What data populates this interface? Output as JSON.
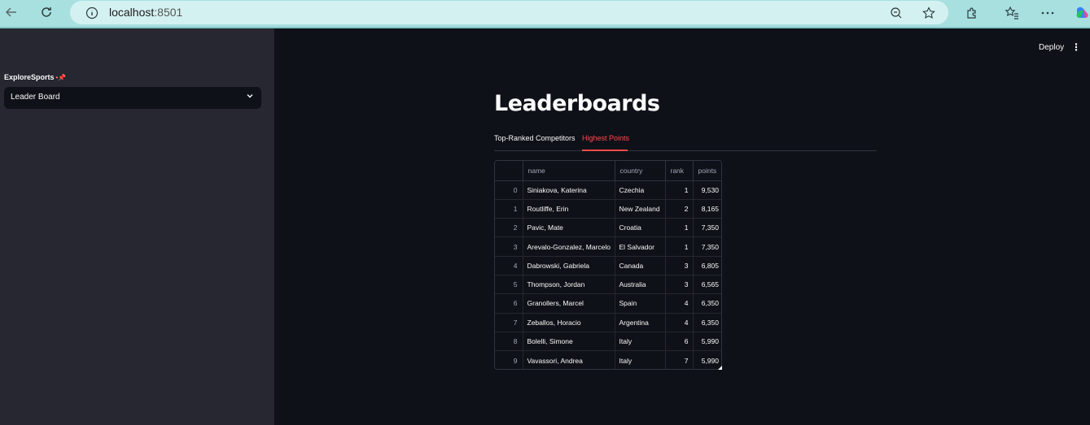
{
  "browser": {
    "url_host": "localhost",
    "url_port": ":8501"
  },
  "sidebar": {
    "label": "ExploreSports",
    "select_value": "Leader Board"
  },
  "header": {
    "deploy_label": "Deploy"
  },
  "main": {
    "title": "Leaderboards",
    "tabs": [
      {
        "label": "Top-Ranked Competitors",
        "active": false
      },
      {
        "label": "Highest Points",
        "active": true
      }
    ]
  },
  "table": {
    "columns": [
      "",
      "name",
      "country",
      "rank",
      "points"
    ],
    "rows": [
      {
        "idx": "0",
        "name": "Siniakova, Katerina",
        "country": "Czechia",
        "rank": "1",
        "points": "9,530"
      },
      {
        "idx": "1",
        "name": "Routliffe, Erin",
        "country": "New Zealand",
        "rank": "2",
        "points": "8,165"
      },
      {
        "idx": "2",
        "name": "Pavic, Mate",
        "country": "Croatia",
        "rank": "1",
        "points": "7,350"
      },
      {
        "idx": "3",
        "name": "Arevalo-Gonzalez, Marcelo",
        "country": "El Salvador",
        "rank": "1",
        "points": "7,350"
      },
      {
        "idx": "4",
        "name": "Dabrowski, Gabriela",
        "country": "Canada",
        "rank": "3",
        "points": "6,805"
      },
      {
        "idx": "5",
        "name": "Thompson, Jordan",
        "country": "Australia",
        "rank": "3",
        "points": "6,565"
      },
      {
        "idx": "6",
        "name": "Granollers, Marcel",
        "country": "Spain",
        "rank": "4",
        "points": "6,350"
      },
      {
        "idx": "7",
        "name": "Zeballos, Horacio",
        "country": "Argentina",
        "rank": "4",
        "points": "6,350"
      },
      {
        "idx": "8",
        "name": "Bolelli, Simone",
        "country": "Italy",
        "rank": "6",
        "points": "5,990"
      },
      {
        "idx": "9",
        "name": "Vavassori, Andrea",
        "country": "Italy",
        "rank": "7",
        "points": "5,990"
      }
    ]
  },
  "colors": {
    "accent": "#ff4b4b",
    "sidebar_bg": "#262730",
    "main_bg": "#0e1117",
    "browser_bar": "#a8e0e0"
  },
  "icons": {
    "back": "arrow-left-icon",
    "reload": "reload-icon",
    "info": "info-icon",
    "zoom": "zoom-out-icon",
    "favorite": "star-icon",
    "extensions": "puzzle-icon",
    "favorites": "favorites-icon",
    "menu": "more-icon",
    "select": "chevron-down-icon",
    "app_menu": "kebab-icon"
  }
}
